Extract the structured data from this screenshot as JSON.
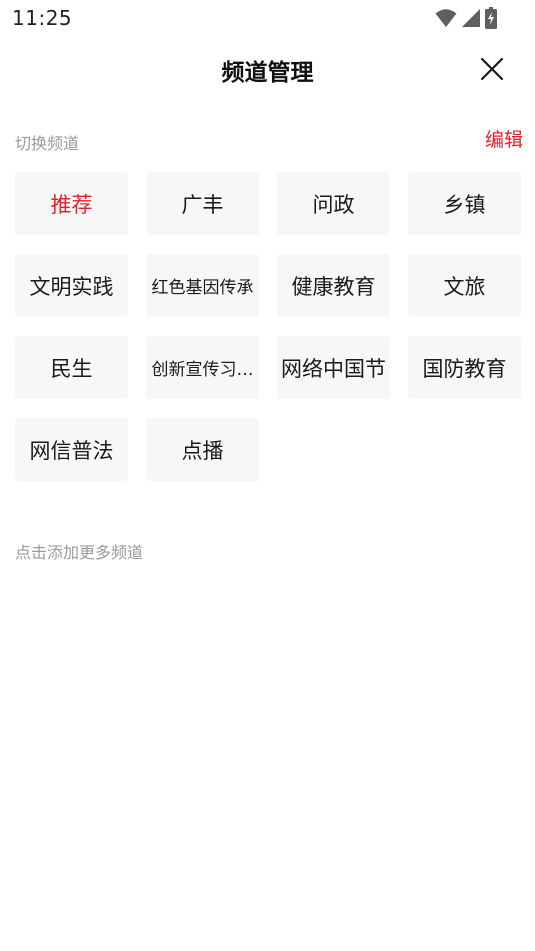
{
  "status_bar": {
    "time": "11:25",
    "icons": [
      "wifi-icon",
      "signal-icon",
      "battery-icon"
    ]
  },
  "header": {
    "title": "频道管理",
    "close_icon": "close-icon"
  },
  "my_channels": {
    "label": "切换频道",
    "edit_label": "编辑",
    "items": [
      {
        "label": "推荐",
        "active": true
      },
      {
        "label": "广丰"
      },
      {
        "label": "问政"
      },
      {
        "label": "乡镇"
      },
      {
        "label": "文明实践"
      },
      {
        "label": "红色基因传承"
      },
      {
        "label": "健康教育"
      },
      {
        "label": "文旅"
      },
      {
        "label": "民生"
      },
      {
        "label": "创新宣传习…"
      },
      {
        "label": "网络中国节"
      },
      {
        "label": "国防教育"
      },
      {
        "label": "网信普法"
      },
      {
        "label": "点播"
      }
    ]
  },
  "more_channels": {
    "label": "点击添加更多频道"
  },
  "colors": {
    "accent": "#e8202d",
    "tile_bg": "#f7f7f7",
    "muted_text": "#9a9a9a"
  }
}
